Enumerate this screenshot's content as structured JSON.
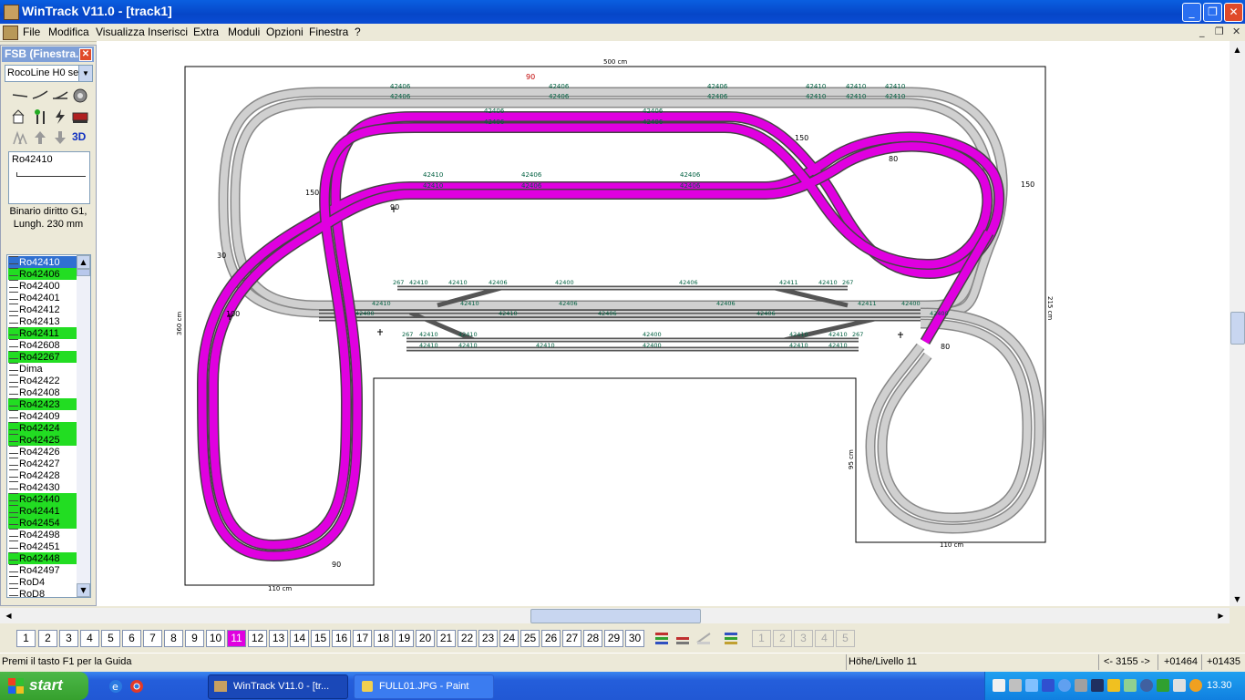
{
  "window": {
    "title": "WinTrack  V11.0 - [track1]",
    "min": "_",
    "max": "❐",
    "close": "✕"
  },
  "menu": [
    "File",
    "Modifica",
    "Visualizza",
    "Inserisci",
    "Extra",
    "Moduli",
    "Opzioni",
    "Finestra",
    "?"
  ],
  "mdi_controls": {
    "min": "_",
    "restore": "❐",
    "close": "✕"
  },
  "fsb": {
    "title": "FSB (Finestra...",
    "close": "✕",
    "catalog": "RocoLine H0 se",
    "three_d": "3D",
    "preview_name": "Ro42410",
    "description": "Binario diritto G1, Lungh. 230 mm",
    "items": [
      {
        "label": "Ro42410",
        "state": "selected"
      },
      {
        "label": "Ro42406",
        "state": "green"
      },
      {
        "label": "Ro42400",
        "state": "normal"
      },
      {
        "label": "Ro42401",
        "state": "normal"
      },
      {
        "label": "Ro42412",
        "state": "normal"
      },
      {
        "label": "Ro42413",
        "state": "normal"
      },
      {
        "label": "Ro42411",
        "state": "green"
      },
      {
        "label": "Ro42608",
        "state": "normal"
      },
      {
        "label": "Ro42267",
        "state": "green"
      },
      {
        "label": "Dima",
        "state": "normal"
      },
      {
        "label": "Ro42422",
        "state": "normal"
      },
      {
        "label": "Ro42408",
        "state": "normal"
      },
      {
        "label": "Ro42423",
        "state": "green"
      },
      {
        "label": "Ro42409",
        "state": "normal"
      },
      {
        "label": "Ro42424",
        "state": "green"
      },
      {
        "label": "Ro42425",
        "state": "green"
      },
      {
        "label": "Ro42426",
        "state": "normal"
      },
      {
        "label": "Ro42427",
        "state": "normal"
      },
      {
        "label": "Ro42428",
        "state": "normal"
      },
      {
        "label": "Ro42430",
        "state": "normal"
      },
      {
        "label": "Ro42440",
        "state": "green"
      },
      {
        "label": "Ro42441",
        "state": "green"
      },
      {
        "label": "Ro42454",
        "state": "green"
      },
      {
        "label": "Ro42498",
        "state": "normal"
      },
      {
        "label": "Ro42451",
        "state": "normal"
      },
      {
        "label": "Ro42448",
        "state": "green"
      },
      {
        "label": "Ro42497",
        "state": "normal"
      },
      {
        "label": "RoD4",
        "state": "normal"
      },
      {
        "label": "RoD8",
        "state": "normal"
      }
    ]
  },
  "drawing": {
    "dims": {
      "top": "500 cm",
      "left": "360 cm",
      "right": "215 cm",
      "inner": "95 cm",
      "bottom_left": "110 cm",
      "bottom_right": "110 cm"
    },
    "radius_labels": [
      "90",
      "150",
      "80",
      "150",
      "90",
      "150",
      "100",
      "30",
      "90",
      "80"
    ],
    "outer_labels": [
      "42406",
      "42406",
      "42406",
      "42410",
      "42410",
      "42410",
      "42406",
      "42406",
      "42406",
      "42410",
      "42410",
      "42410"
    ],
    "magenta_top_labels": [
      "42406",
      "42406",
      "42406",
      "42406"
    ],
    "magenta_mid_labels": [
      "42410",
      "42406",
      "42406",
      "42410",
      "42406",
      "42406"
    ],
    "station_labels": [
      "267",
      "42410",
      "42410",
      "42400",
      "42406",
      "42411",
      "42410",
      "267",
      "42410",
      "42406",
      "42410",
      "42406",
      "42406",
      "42406",
      "42400",
      "267",
      "42410",
      "42410",
      "42410",
      "42410",
      "42400",
      "42400",
      "42410",
      "42410",
      "267",
      "42410",
      "42406",
      "42400",
      "42410",
      "42410",
      "42411",
      "42400",
      "42410"
    ],
    "track_colors": {
      "outer": "#c8c8c8",
      "inner": "#e000e0"
    }
  },
  "layers": [
    "1",
    "2",
    "3",
    "4",
    "5",
    "6",
    "7",
    "8",
    "9",
    "10",
    "11",
    "12",
    "13",
    "14",
    "15",
    "16",
    "17",
    "18",
    "19",
    "20",
    "21",
    "22",
    "23",
    "24",
    "25",
    "26",
    "27",
    "28",
    "29",
    "30"
  ],
  "active_layer": "11",
  "layer_tools": [
    "1",
    "2",
    "3",
    "4",
    "5"
  ],
  "status": {
    "help": "Premi il tasto F1 per la Guida",
    "level": "Höhe/Livello 11",
    "coord": "<- 3155 ->",
    "x": "+01464",
    "y": "+01435"
  },
  "taskbar": {
    "start": "start",
    "tasks": [
      "WinTrack  V11.0 - [tr...",
      "FULL01.JPG - Paint"
    ],
    "clock": "13.30"
  }
}
